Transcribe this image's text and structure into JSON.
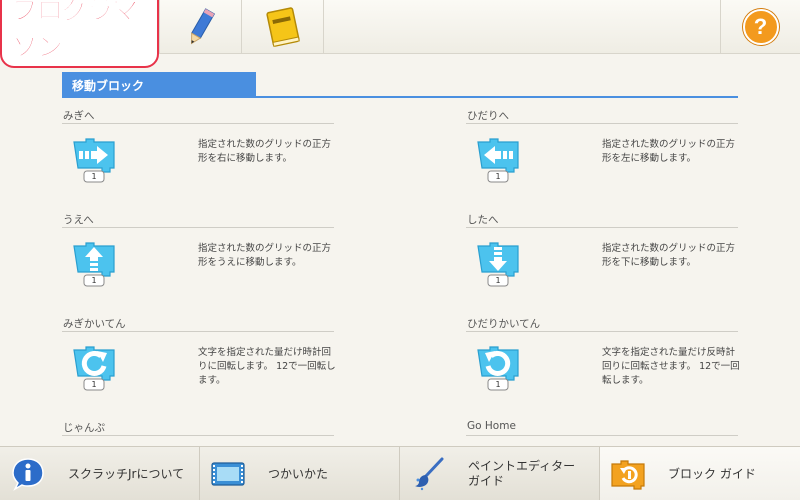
{
  "header": {
    "logo_text": "プログラマソン",
    "help_label": "?"
  },
  "section": {
    "title": "移動ブロック"
  },
  "entries": [
    {
      "title": "みぎへ",
      "desc": "指定された数のグリッドの正方形を右に移動します。",
      "block_value": "1",
      "icon": "arrow-right-icon"
    },
    {
      "title": "ひだりへ",
      "desc": "指定された数のグリッドの正方形を左に移動します。",
      "block_value": "1",
      "icon": "arrow-left-icon"
    },
    {
      "title": "うえへ",
      "desc": "指定された数のグリッドの正方形をうえに移動します。",
      "block_value": "1",
      "icon": "arrow-up-icon"
    },
    {
      "title": "したへ",
      "desc": "指定された数のグリッドの正方形を下に移動します。",
      "block_value": "1",
      "icon": "arrow-down-icon"
    },
    {
      "title": "みぎかいてん",
      "desc": "文字を指定された量だけ時計回りに回転します。 12で一回転します。",
      "block_value": "1",
      "icon": "rotate-clockwise-icon"
    },
    {
      "title": "ひだりかいてん",
      "desc": "文字を指定された量だけ反時計回りに回転させます。 12で一回転します。",
      "block_value": "1",
      "icon": "rotate-counterclockwise-icon"
    },
    {
      "title": "じゃんぷ",
      "desc": "",
      "block_value": "",
      "icon": ""
    },
    {
      "title": "Go Home",
      "desc": "",
      "block_value": "",
      "icon": ""
    }
  ],
  "bottom_nav": [
    {
      "label": "スクラッチJrについて",
      "icon": "info-icon"
    },
    {
      "label": "つかいかた",
      "icon": "film-icon"
    },
    {
      "label": "ペイントエディター\nガイド",
      "icon": "paintbrush-icon"
    },
    {
      "label": "ブロック ガイド",
      "icon": "block-guide-icon"
    }
  ],
  "colors": {
    "accent_blue": "#4a8fe0",
    "block_blue": "#4cc3ee",
    "help_orange": "#f39a1e",
    "logo_red": "#e8334a"
  }
}
